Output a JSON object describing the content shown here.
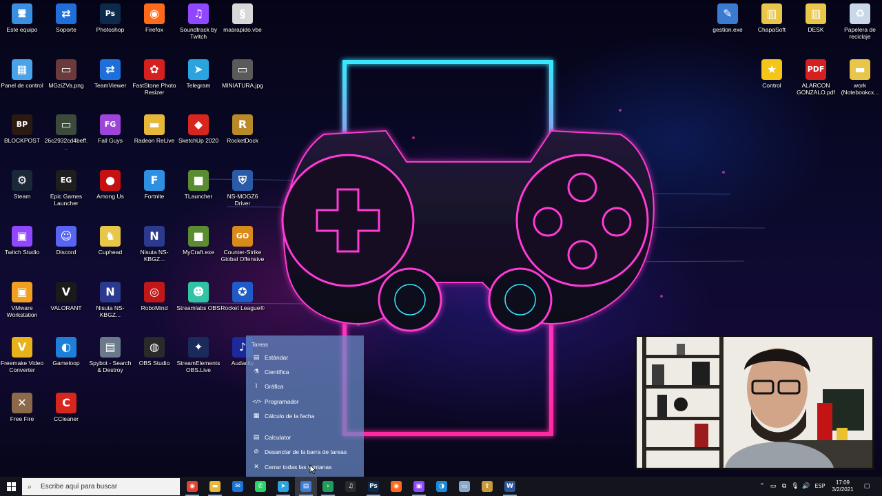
{
  "desktop": {
    "icons": [
      {
        "label": "Este equipo",
        "icon": "computer-icon",
        "color": "#3b8fe0",
        "glyph": "🖥"
      },
      {
        "label": "Soporte",
        "icon": "teamviewer-icon",
        "color": "#1e6fd9",
        "glyph": "⇄"
      },
      {
        "label": "Photoshop",
        "icon": "photoshop-icon",
        "color": "#0c2a4b",
        "glyph": "Ps"
      },
      {
        "label": "Firefox",
        "icon": "firefox-icon",
        "color": "#ff6a1a",
        "glyph": "◉"
      },
      {
        "label": "Soundtrack by Twitch",
        "icon": "twitch-icon",
        "color": "#9146ff",
        "glyph": "♫"
      },
      {
        "label": "masrapido.vbe",
        "icon": "script-icon",
        "color": "#d8d8d8",
        "glyph": "§"
      },
      {
        "label": "Panel de control",
        "icon": "control-panel-icon",
        "color": "#4aa3e8",
        "glyph": "▦"
      },
      {
        "label": "MGziZVa.png",
        "icon": "image-file-icon",
        "color": "#6b3a3a",
        "glyph": "▭"
      },
      {
        "label": "TeamViewer",
        "icon": "teamviewer-icon",
        "color": "#1e6fd9",
        "glyph": "⇄"
      },
      {
        "label": "FastStone Photo Resizer",
        "icon": "faststone-icon",
        "color": "#d61f1f",
        "glyph": "✿"
      },
      {
        "label": "Telegram",
        "icon": "telegram-icon",
        "color": "#2aa3df",
        "glyph": "➤"
      },
      {
        "label": "MINIATURA.jpg",
        "icon": "image-file-icon",
        "color": "#5a5a5a",
        "glyph": "▭"
      },
      {
        "label": "BLOCKPOST",
        "icon": "blockpost-icon",
        "color": "#2b1a12",
        "glyph": "BP"
      },
      {
        "label": "26c2932cd4beff...",
        "icon": "image-file-icon",
        "color": "#3c4a3c",
        "glyph": "▭"
      },
      {
        "label": "Fall Guys",
        "icon": "fall-guys-icon",
        "color": "#9d44d9",
        "glyph": "FG"
      },
      {
        "label": "Radeon ReLive",
        "icon": "folder-icon",
        "color": "#e6b83a",
        "glyph": "▬"
      },
      {
        "label": "SketchUp 2020",
        "icon": "sketchup-icon",
        "color": "#d6261d",
        "glyph": "◆"
      },
      {
        "label": "RocketDock",
        "icon": "rocketdock-icon",
        "color": "#b88a2a",
        "glyph": "R"
      },
      {
        "label": "Steam",
        "icon": "steam-icon",
        "color": "#1b2838",
        "glyph": "⚙"
      },
      {
        "label": "Epic Games Launcher",
        "icon": "epic-games-icon",
        "color": "#1e1e1e",
        "glyph": "EG"
      },
      {
        "label": "Among Us",
        "icon": "among-us-icon",
        "color": "#c51111",
        "glyph": "●"
      },
      {
        "label": "Fortnite",
        "icon": "fortnite-icon",
        "color": "#2f8fe0",
        "glyph": "F"
      },
      {
        "label": "TLauncher",
        "icon": "minecraft-icon",
        "color": "#5b8c32",
        "glyph": "■"
      },
      {
        "label": "NS-MOGZ6 Driver",
        "icon": "driver-icon",
        "color": "#2a5ba8",
        "glyph": "⛨"
      },
      {
        "label": "Twitch Studio",
        "icon": "twitch-icon",
        "color": "#9146ff",
        "glyph": "▣"
      },
      {
        "label": "Discord",
        "icon": "discord-icon",
        "color": "#5865f2",
        "glyph": "☺"
      },
      {
        "label": "Cuphead",
        "icon": "cuphead-icon",
        "color": "#e8c64a",
        "glyph": "♞"
      },
      {
        "label": "Nisuta NS-KBGZ...",
        "icon": "nisuta-icon",
        "color": "#2b3a8c",
        "glyph": "N"
      },
      {
        "label": "MyCraft.exe",
        "icon": "minecraft-icon",
        "color": "#5b8c32",
        "glyph": "■"
      },
      {
        "label": "Counter-Strike Global Offensive",
        "icon": "csgo-icon",
        "color": "#d88a1a",
        "glyph": "GO"
      },
      {
        "label": "VMware Workstation",
        "icon": "vmware-icon",
        "color": "#f0a020",
        "glyph": "▣"
      },
      {
        "label": "VALORANT",
        "icon": "valorant-icon",
        "color": "#1a1a1a",
        "glyph": "V"
      },
      {
        "label": "Nisuta NS-KBGZ...",
        "icon": "nisuta-icon",
        "color": "#2b3a8c",
        "glyph": "N"
      },
      {
        "label": "RoboMind",
        "icon": "robomind-icon",
        "color": "#c01818",
        "glyph": "◎"
      },
      {
        "label": "Streamlabs OBS",
        "icon": "streamlabs-icon",
        "color": "#31c3a2",
        "glyph": "☻"
      },
      {
        "label": "Rocket League®",
        "icon": "rocket-league-icon",
        "color": "#1e5bc6",
        "glyph": "✪"
      },
      {
        "label": "Freemake Video Converter",
        "icon": "freemake-icon",
        "color": "#e8b21a",
        "glyph": "V"
      },
      {
        "label": "Gameloop",
        "icon": "gameloop-icon",
        "color": "#1e7fd9",
        "glyph": "◐"
      },
      {
        "label": "Spybot - Search & Destroy",
        "icon": "spybot-icon",
        "color": "#6a7a8a",
        "glyph": "▤"
      },
      {
        "label": "OBS Studio",
        "icon": "obs-icon",
        "color": "#2a2a2a",
        "glyph": "◍"
      },
      {
        "label": "StreamElements OBS.Live",
        "icon": "streamelements-icon",
        "color": "#1a2a5a",
        "glyph": "✦"
      },
      {
        "label": "Audacity",
        "icon": "audacity-icon",
        "color": "#1a2a9a",
        "glyph": "♪"
      },
      {
        "label": "Free Fire",
        "icon": "free-fire-icon",
        "color": "#8a6a4a",
        "glyph": "✕"
      },
      {
        "label": "CCleaner",
        "icon": "ccleaner-icon",
        "color": "#d6261d",
        "glyph": "C"
      },
      {
        "label": "gestion.exe",
        "icon": "exe-icon",
        "color": "#3a7ad0",
        "glyph": "✎"
      },
      {
        "label": "ChapaSoft",
        "icon": "folder-zip-icon",
        "color": "#e8c64a",
        "glyph": "▥"
      },
      {
        "label": "DESK",
        "icon": "folder-zip-icon",
        "color": "#e8c64a",
        "glyph": "▥"
      },
      {
        "label": "Papelera de reciclaje",
        "icon": "recycle-bin-icon",
        "color": "#c8d8e8",
        "glyph": "♻"
      },
      {
        "label": "Control",
        "icon": "star-icon",
        "color": "#f5c518",
        "glyph": "★"
      },
      {
        "label": "ALARCON GONZALO.pdf",
        "icon": "pdf-icon",
        "color": "#d42020",
        "glyph": "PDF"
      },
      {
        "label": "work (Notebookcx...",
        "icon": "folder-shortcut-icon",
        "color": "#e8c64a",
        "glyph": "▬"
      }
    ]
  },
  "jumplist": {
    "header": "Tareas",
    "tasks": [
      {
        "label": "Estándar",
        "icon": "calculator-standard-icon",
        "glyph": "▤"
      },
      {
        "label": "Científica",
        "icon": "flask-icon",
        "glyph": "⚗"
      },
      {
        "label": "Gráfica",
        "icon": "graph-icon",
        "glyph": "⌇"
      },
      {
        "label": "Programador",
        "icon": "code-icon",
        "glyph": "</>"
      },
      {
        "label": "Cálculo de la fecha",
        "icon": "calendar-icon",
        "glyph": "▦"
      }
    ],
    "actions": [
      {
        "label": "Calculator",
        "icon": "calculator-icon",
        "glyph": "▤"
      },
      {
        "label": "Desanclar de la barra de tareas",
        "icon": "unpin-icon",
        "glyph": "⊘"
      },
      {
        "label": "Cerrar todas las ventanas",
        "icon": "close-icon",
        "glyph": "✕"
      }
    ]
  },
  "taskbar": {
    "search_placeholder": "Escribe aquí para buscar",
    "apps": [
      {
        "name": "chrome",
        "icon": "chrome-icon",
        "color": "#e34133",
        "glyph": "◉"
      },
      {
        "name": "file-explorer",
        "icon": "folder-icon",
        "color": "#e8b83a",
        "glyph": "▬"
      },
      {
        "name": "mail",
        "icon": "mail-icon",
        "color": "#1a73d9",
        "glyph": "✉"
      },
      {
        "name": "whatsapp",
        "icon": "whatsapp-icon",
        "color": "#25d366",
        "glyph": "✆"
      },
      {
        "name": "telegram",
        "icon": "telegram-icon",
        "color": "#2aa3df",
        "glyph": "➤"
      },
      {
        "name": "calculator",
        "icon": "calculator-icon",
        "color": "#3c7bd8",
        "glyph": "▤"
      },
      {
        "name": "terminal",
        "icon": "chevron-right-icon",
        "color": "#1e9e5a",
        "glyph": "›"
      },
      {
        "name": "itunes",
        "icon": "music-icon",
        "color": "#2a2a2a",
        "glyph": "♫"
      },
      {
        "name": "photoshop",
        "icon": "photoshop-icon",
        "color": "#0c2a4b",
        "glyph": "Ps"
      },
      {
        "name": "firefox",
        "icon": "firefox-icon",
        "color": "#ff6a1a",
        "glyph": "◉"
      },
      {
        "name": "twitch",
        "icon": "twitch-icon",
        "color": "#9146ff",
        "glyph": "▣"
      },
      {
        "name": "edge",
        "icon": "edge-icon",
        "color": "#1d8ad9",
        "glyph": "◑"
      },
      {
        "name": "notes",
        "icon": "document-icon",
        "color": "#8aa8c8",
        "glyph": "▭"
      },
      {
        "name": "streamelements",
        "icon": "rocket-icon",
        "color": "#c89a3a",
        "glyph": "⇧"
      },
      {
        "name": "word",
        "icon": "word-icon",
        "color": "#2b579a",
        "glyph": "W"
      }
    ],
    "tray": {
      "language": "ESP",
      "time": "17:09",
      "date": "3/2/2021"
    }
  }
}
